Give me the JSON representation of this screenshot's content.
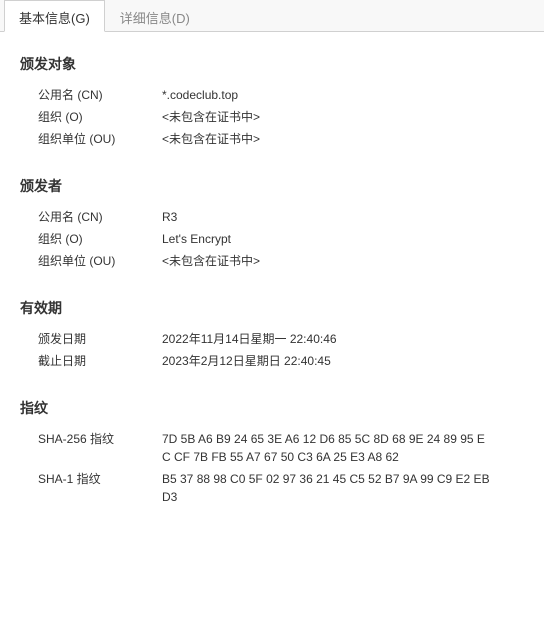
{
  "tabs": {
    "basic": "基本信息(G)",
    "detail": "详细信息(D)"
  },
  "subject": {
    "title": "颁发对象",
    "cn_label": "公用名 (CN)",
    "cn_value": "*.codeclub.top",
    "o_label": "组织 (O)",
    "o_value": "<未包含在证书中>",
    "ou_label": "组织单位 (OU)",
    "ou_value": "<未包含在证书中>"
  },
  "issuer": {
    "title": "颁发者",
    "cn_label": "公用名 (CN)",
    "cn_value": "R3",
    "o_label": "组织 (O)",
    "o_value": "Let's Encrypt",
    "ou_label": "组织单位 (OU)",
    "ou_value": "<未包含在证书中>"
  },
  "validity": {
    "title": "有效期",
    "issued_label": "颁发日期",
    "issued_value": "2022年11月14日星期一 22:40:46",
    "expires_label": "截止日期",
    "expires_value": "2023年2月12日星期日 22:40:45"
  },
  "fingerprints": {
    "title": "指纹",
    "sha256_label": "SHA-256 指纹",
    "sha256_value": "7D 5B A6 B9 24 65 3E A6 12 D6 85 5C 8D 68 9E 24 89 95 EC CF 7B FB 55 A7 67 50 C3 6A 25 E3 A8 62",
    "sha1_label": "SHA-1 指纹",
    "sha1_value": "B5 37 88 98 C0 5F 02 97 36 21 45 C5 52 B7 9A 99 C9 E2 EB D3"
  }
}
